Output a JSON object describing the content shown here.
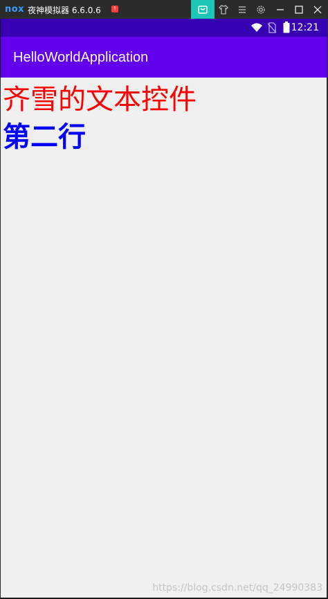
{
  "emulator": {
    "logo": "nox",
    "title": "夜神模拟器 6.6.0.6",
    "alert": "!",
    "icons": [
      "gift-icon",
      "shirt-icon",
      "menu-icon",
      "settings-icon",
      "minimize-icon",
      "maximize-icon",
      "close-icon"
    ]
  },
  "status_bar": {
    "time": "12:21",
    "icons": [
      "wifi-icon",
      "no-sim-icon",
      "battery-icon"
    ]
  },
  "app_bar": {
    "title": "HelloWorldApplication"
  },
  "content": {
    "line1": {
      "text": "齐雪的文本控件",
      "color": "#ff0000"
    },
    "line2": {
      "text": "第二行",
      "color": "#0000ff"
    }
  },
  "watermark": "https://blog.csdn.net/qq_24990383",
  "colors": {
    "status_bar": "#3700b3",
    "app_bar": "#6200ee",
    "gift_button": "#1cc5b4",
    "background": "#f0f0f0"
  }
}
